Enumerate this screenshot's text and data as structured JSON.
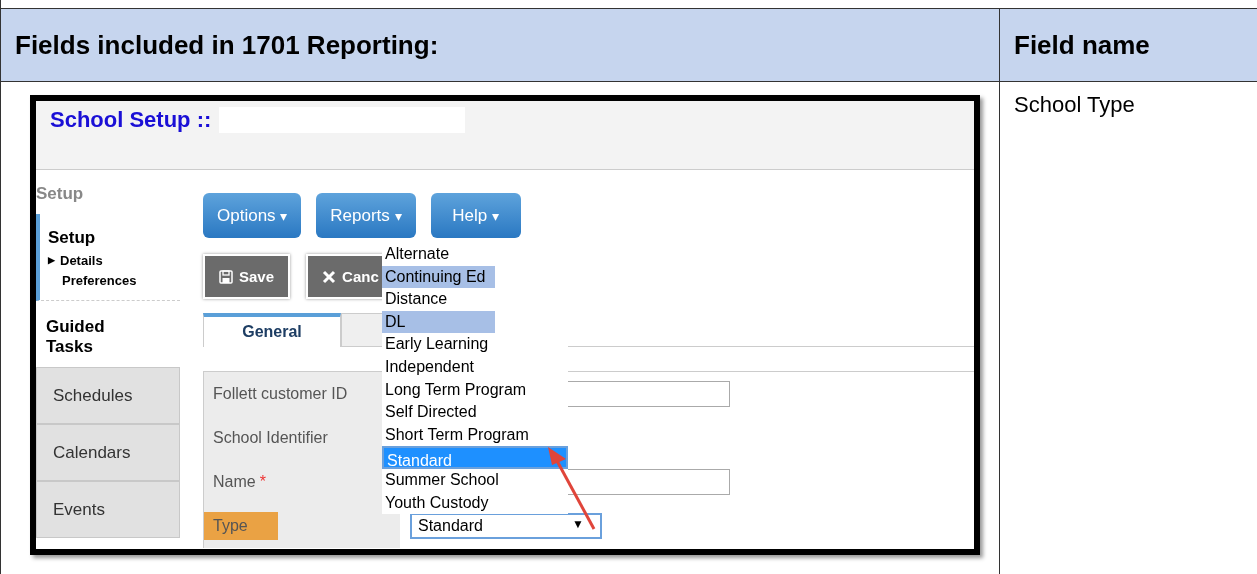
{
  "table": {
    "columns": [
      "Fields included in 1701 Reporting:",
      "Field name"
    ],
    "rows": [
      {
        "field_name": "School Type",
        "screenshot": {
          "title": "School Setup ::",
          "sidebar": {
            "header": "Setup",
            "section": "Setup",
            "items": [
              {
                "label": "Details",
                "marker": "▶",
                "expanded": false
              },
              {
                "label": "Preferences"
              }
            ],
            "guided": "Guided Tasks",
            "tabs": [
              "Schedules",
              "Calendars",
              "Events"
            ]
          },
          "menu_buttons": [
            {
              "label": "Options",
              "caret": "▾"
            },
            {
              "label": "Reports",
              "caret": "▾"
            },
            {
              "label": "Help",
              "caret": "▾"
            }
          ],
          "action_buttons": [
            {
              "label": "Save",
              "kind": "save"
            },
            {
              "label": "Canc",
              "kind": "cancel"
            }
          ],
          "tabs": [
            {
              "label": "General",
              "selected": true
            },
            {
              "selected": false
            }
          ],
          "form": [
            {
              "label": "Follett customer ID",
              "highlighted": false,
              "kind": "input"
            },
            {
              "label": "School Identifier",
              "highlighted": false,
              "kind": "none"
            },
            {
              "label": "Name",
              "required_mark": "*",
              "highlighted": false,
              "kind": "input"
            },
            {
              "label": "Type",
              "highlighted": true,
              "kind": "select",
              "value": "Standard",
              "caret": "▼"
            }
          ],
          "dropdown": [
            {
              "label": "Alternate",
              "highlighted": false,
              "selected": false
            },
            {
              "label": "Continuing Ed",
              "highlighted": true,
              "selected": false
            },
            {
              "label": "Distance",
              "highlighted": false,
              "selected": false
            },
            {
              "label": "DL",
              "highlighted": true,
              "selected": false
            },
            {
              "label": "Early Learning",
              "highlighted": false,
              "selected": false
            },
            {
              "label": "Independent",
              "highlighted": false,
              "selected": false
            },
            {
              "label": "Long Term Program",
              "highlighted": false,
              "selected": false
            },
            {
              "label": "Self Directed",
              "highlighted": false,
              "selected": false
            },
            {
              "label": "Short Term Program",
              "highlighted": false,
              "selected": false
            },
            {
              "label": "Standard",
              "highlighted": false,
              "selected": true
            },
            {
              "label": "Summer School",
              "highlighted": false,
              "selected": false
            },
            {
              "label": "Youth Custody",
              "highlighted": false,
              "selected": false
            }
          ]
        }
      }
    ]
  }
}
